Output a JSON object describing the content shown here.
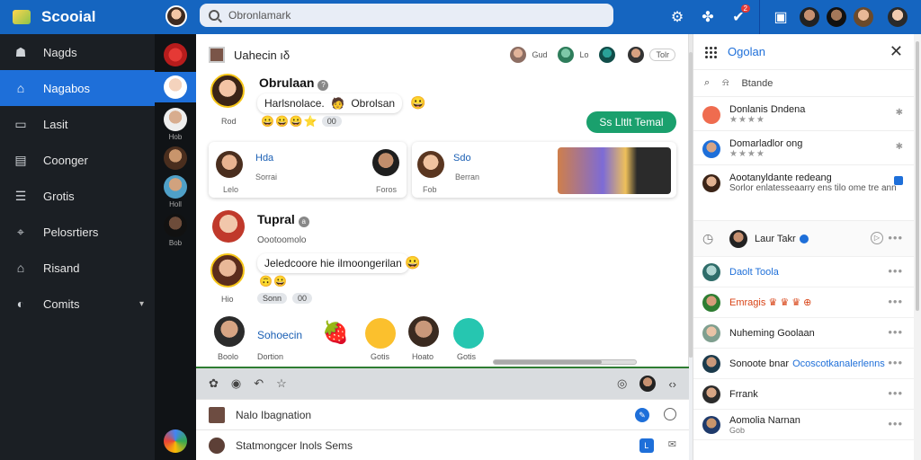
{
  "app": {
    "brand": "Scooial",
    "search_placeholder": "Obronlamark"
  },
  "topbar": {
    "notification_count": "2"
  },
  "nav": [
    {
      "label": "Nagds",
      "icon": "user-icon"
    },
    {
      "label": "Nagabos",
      "icon": "home-icon",
      "active": true
    },
    {
      "label": "Lasit",
      "icon": "message-icon"
    },
    {
      "label": "Coonger",
      "icon": "calendar-icon"
    },
    {
      "label": "Grotis",
      "icon": "list-icon"
    },
    {
      "label": "Pelosrtiers",
      "icon": "tag-icon"
    },
    {
      "label": "Risand",
      "icon": "store-icon"
    },
    {
      "label": "Comits",
      "icon": "settings-icon",
      "chevron": true
    }
  ],
  "rail": {
    "labels": [
      "Hob",
      "Holl",
      "Bob"
    ]
  },
  "feed": {
    "header": {
      "title": "Uahecin ıδ",
      "user_a": "Gud",
      "user_b": "Lo",
      "pill": "Tolr"
    },
    "post1": {
      "name": "Obrulaan",
      "badge": "?",
      "text": "Harlsnolace.",
      "text2": "Obrolsan",
      "time": "Rod",
      "emojis": "😀😀😀⭐",
      "chip": "00",
      "cta": "Ss Lltlt Temal"
    },
    "cards": [
      {
        "title": "Hda",
        "sub": "Sorrai",
        "left_lbl": "Lelo",
        "right_lbl": "Foros"
      },
      {
        "title": "Sdo",
        "sub": "Berran",
        "left_lbl": "Fob"
      }
    ],
    "post2": {
      "name": "Tupral",
      "badge": "a",
      "sub": "Oootoomolo"
    },
    "post3": {
      "text": "Jeledcoore hie ilmoongerilan",
      "time": "Hio",
      "emojis": "🙃😀",
      "chip_a": "Sonn",
      "chip_b": "00"
    },
    "stories": [
      {
        "label": "Boolo"
      },
      {
        "label": "Sohoecin",
        "sub": "Dortion"
      },
      {
        "label": "Gotis"
      },
      {
        "label": "Hoato"
      },
      {
        "label": "Gotis"
      }
    ],
    "comments": [
      {
        "text": "Nalo Ibagnation"
      },
      {
        "text": "Statmongcer lnols Sems"
      }
    ]
  },
  "right": {
    "title": "Ogolan",
    "search_label": "Btande",
    "top": [
      {
        "name": "Donlanis Dndena",
        "stars": "★★★★"
      },
      {
        "name": "Domarladlor ong",
        "stars": "★★★★"
      },
      {
        "name": "Aootanyldante redeang",
        "sub": "Sorlor enlatesseaarry ens tilo ome tre ann"
      }
    ],
    "header_row": {
      "name": "Laur Takr"
    },
    "list": [
      {
        "name": "Daolt Toola",
        "color": "#1e6fd9"
      },
      {
        "name": "Emragis ♛ ♛ ♛ ⊕",
        "color": "#d84315"
      },
      {
        "name": "Nuheming Goolaan",
        "color": "#222222"
      },
      {
        "name": "Sonoote bnar",
        "extra": "Ocoscotkanalerlenns",
        "color": "#222222"
      },
      {
        "name": "Frrank",
        "color": "#222222"
      },
      {
        "name": "Aomolia Narnan",
        "sub": "Gob",
        "color": "#222222"
      }
    ]
  }
}
